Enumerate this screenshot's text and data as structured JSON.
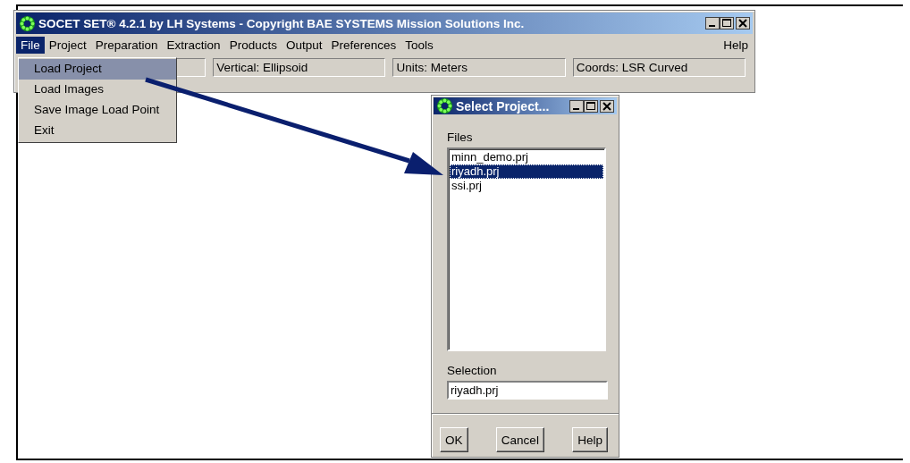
{
  "main_window": {
    "title": "SOCET SET® 4.2.1  by LH Systems - Copyright BAE SYSTEMS Mission Solutions Inc.",
    "menu": [
      {
        "label": "File",
        "selected": true
      },
      {
        "label": "Project",
        "selected": false
      },
      {
        "label": "Preparation",
        "selected": false
      },
      {
        "label": "Extraction",
        "selected": false
      },
      {
        "label": "Products",
        "selected": false
      },
      {
        "label": "Output",
        "selected": false
      },
      {
        "label": "Preferences",
        "selected": false
      },
      {
        "label": "Tools",
        "selected": false
      }
    ],
    "help_menu": "Help",
    "status_fields": [
      "Vertical: Ellipsoid",
      "Units: Meters",
      "Coords: LSR Curved"
    ]
  },
  "file_menu": [
    {
      "label": "Load Project",
      "selected": true
    },
    {
      "label": "Load Images",
      "selected": false
    },
    {
      "label": "Save Image Load Point",
      "selected": false
    },
    {
      "label": "Exit",
      "selected": false
    }
  ],
  "dialog": {
    "title": "Select Project...",
    "files_label": "Files",
    "files": [
      {
        "name": "minn_demo.prj",
        "selected": false
      },
      {
        "name": "riyadh.prj",
        "selected": true
      },
      {
        "name": "ssi.prj",
        "selected": false
      }
    ],
    "selection_label": "Selection",
    "selection_value": "riyadh.prj",
    "buttons": [
      "OK",
      "Cancel",
      "Help"
    ]
  }
}
